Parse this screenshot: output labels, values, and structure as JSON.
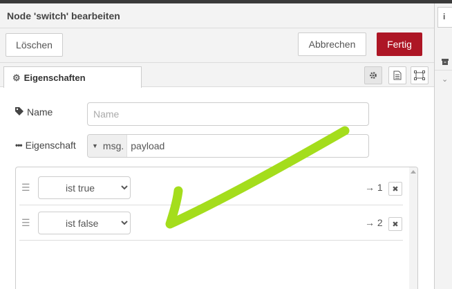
{
  "tray": {
    "title": "Node 'switch' bearbeiten"
  },
  "toolbar": {
    "delete_label": "Löschen",
    "cancel_label": "Abbrechen",
    "done_label": "Fertig"
  },
  "tabs": {
    "properties_label": "Eigenschaften"
  },
  "form": {
    "name_label": "Name",
    "name_value": "",
    "name_placeholder": "Name",
    "property_label": "Eigenschaft",
    "property_type": "msg.",
    "property_value": "payload"
  },
  "rules": [
    {
      "operator": "ist true",
      "output": "→ 1"
    },
    {
      "operator": "ist false",
      "output": "→ 2"
    }
  ],
  "colors": {
    "accent": "#ad1625",
    "annotation": "#a4dd1c"
  },
  "icons": {
    "tab": "gear-icon",
    "name_label": "tag-icon",
    "property_label": "ellipsis-icon",
    "rule_handle": "drag-handle-icon",
    "rule_remove": "close-icon"
  }
}
